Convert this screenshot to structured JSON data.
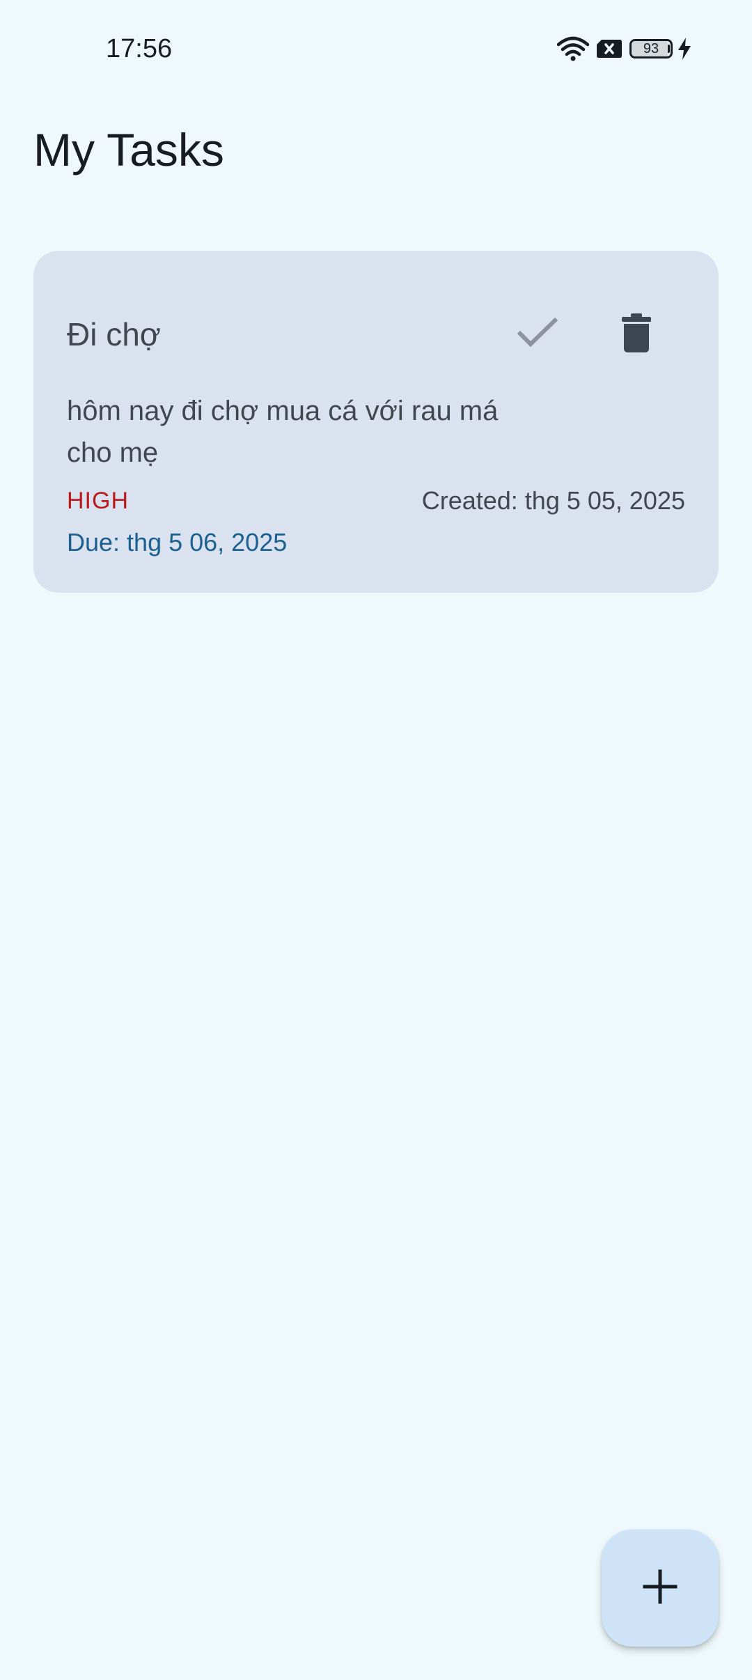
{
  "status_bar": {
    "time": "17:56",
    "battery_level": "93",
    "battery_fraction": 0.93,
    "icons": [
      "wifi-icon",
      "no-sim-icon",
      "battery-icon",
      "charging-bolt-icon"
    ]
  },
  "header": {
    "title": "My Tasks"
  },
  "tasks": [
    {
      "title": "Đi chợ",
      "description": "hôm nay đi chợ mua cá với rau má cho mẹ",
      "priority": "HIGH",
      "created": "Created: thg 5 05, 2025",
      "due": "Due: thg 5 06, 2025",
      "actions": {
        "complete_icon": "check-icon",
        "delete_icon": "trash-icon"
      }
    }
  ],
  "fab": {
    "icon": "plus-icon"
  },
  "colors": {
    "background": "#eff9fd",
    "card": "#dae2ef",
    "priority_high": "#ba1a1a",
    "due": "#1b6091",
    "fab": "#cfe3f8"
  }
}
